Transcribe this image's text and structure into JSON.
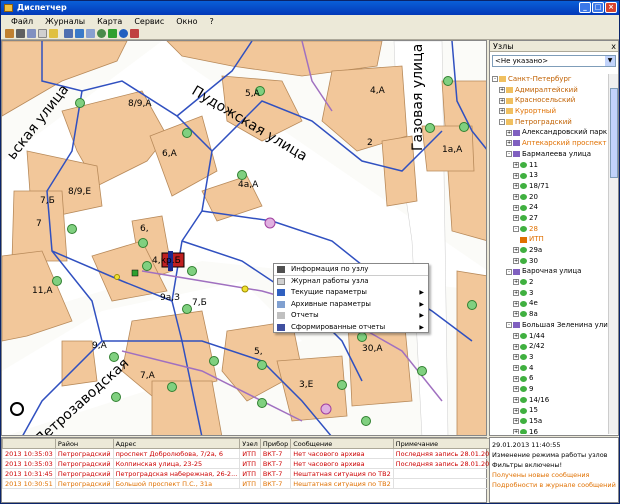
{
  "window": {
    "title": "Диспетчер",
    "buttons": {
      "min": "_",
      "max": "□",
      "close": "×"
    }
  },
  "menu": [
    "Файл",
    "Журналы",
    "Карта",
    "Сервис",
    "Окно",
    "?"
  ],
  "map": {
    "streets": [
      "Пудожская улица",
      "Газовая улица",
      "Петрозаводская",
      "ьская улица"
    ],
    "buildings": [
      "5,А",
      "4,А",
      "8/9,А",
      "6,А",
      "2",
      "1а,А",
      "8/9,Е",
      "7,Б",
      "4а,А",
      "7",
      "6,",
      "4,кр.Б",
      "11,А",
      "9а,З",
      "7,Б",
      "9,А",
      "7,А",
      "5,",
      "3,Е",
      "30,А"
    ]
  },
  "context_menu": [
    {
      "label": "Информация по узлу",
      "sub": false
    },
    {
      "label": "Журнал работы узла",
      "sub": false
    },
    {
      "label": "Текущие параметры",
      "sub": true
    },
    {
      "label": "Архивные параметры",
      "sub": true
    },
    {
      "label": "Отчеты",
      "sub": true
    },
    {
      "label": "Сформированные отчеты",
      "sub": true
    }
  ],
  "right_panel": {
    "title": "Узлы",
    "close": "x",
    "combo_value": "<Не указано>",
    "tree": [
      {
        "label": "Санкт-Петербург",
        "lvl": 0,
        "kind": "folder",
        "color": "#c06000",
        "exp": "-"
      },
      {
        "label": "Адмиралтейский",
        "lvl": 1,
        "kind": "folder",
        "color": "#c06000",
        "exp": "+"
      },
      {
        "label": "Красносельский",
        "lvl": 1,
        "kind": "folder",
        "color": "#c06000",
        "exp": "+"
      },
      {
        "label": "Курортный",
        "lvl": 1,
        "kind": "folder",
        "color": "#e07000",
        "exp": "+"
      },
      {
        "label": "Петроградский",
        "lvl": 1,
        "kind": "folder",
        "color": "#c06000",
        "exp": "-"
      },
      {
        "label": "Александровский парк",
        "lvl": 2,
        "kind": "street",
        "color": "#000",
        "exp": "+"
      },
      {
        "label": "Аптекарский проспект",
        "lvl": 2,
        "kind": "street",
        "color": "#e07000",
        "exp": "+"
      },
      {
        "label": "Бармалеева улица",
        "lvl": 2,
        "kind": "street",
        "color": "#000",
        "exp": "-"
      },
      {
        "label": "11",
        "lvl": 3,
        "kind": "node",
        "color": "#000",
        "exp": "+"
      },
      {
        "label": "13",
        "lvl": 3,
        "kind": "node",
        "color": "#000",
        "exp": "+"
      },
      {
        "label": "18/71",
        "lvl": 3,
        "kind": "node",
        "color": "#000",
        "exp": "+"
      },
      {
        "label": "20",
        "lvl": 3,
        "kind": "node",
        "color": "#000",
        "exp": "+"
      },
      {
        "label": "24",
        "lvl": 3,
        "kind": "node",
        "color": "#000",
        "exp": "+"
      },
      {
        "label": "27",
        "lvl": 3,
        "kind": "node",
        "color": "#000",
        "exp": "+"
      },
      {
        "label": "28",
        "lvl": 3,
        "kind": "node",
        "color": "#e07000",
        "exp": "-"
      },
      {
        "label": "ИТП",
        "lvl": 4,
        "kind": "itp",
        "color": "#e07000",
        "exp": ""
      },
      {
        "label": "29а",
        "lvl": 3,
        "kind": "node",
        "color": "#000",
        "exp": "+"
      },
      {
        "label": "30",
        "lvl": 3,
        "kind": "node",
        "color": "#000",
        "exp": "+"
      },
      {
        "label": "Барочная улица",
        "lvl": 2,
        "kind": "street",
        "color": "#000",
        "exp": "-"
      },
      {
        "label": "2",
        "lvl": 3,
        "kind": "node",
        "color": "#000",
        "exp": "+"
      },
      {
        "label": "3",
        "lvl": 3,
        "kind": "node",
        "color": "#000",
        "exp": "+"
      },
      {
        "label": "4е",
        "lvl": 3,
        "kind": "node",
        "color": "#000",
        "exp": "+"
      },
      {
        "label": "8а",
        "lvl": 3,
        "kind": "node",
        "color": "#000",
        "exp": "+"
      },
      {
        "label": "Большая Зеленина улица",
        "lvl": 2,
        "kind": "street",
        "color": "#000",
        "exp": "-"
      },
      {
        "label": "1/44",
        "lvl": 3,
        "kind": "node",
        "color": "#000",
        "exp": "+"
      },
      {
        "label": "2/42",
        "lvl": 3,
        "kind": "node",
        "color": "#000",
        "exp": "+"
      },
      {
        "label": "3",
        "lvl": 3,
        "kind": "node",
        "color": "#000",
        "exp": "+"
      },
      {
        "label": "4",
        "lvl": 3,
        "kind": "node",
        "color": "#000",
        "exp": "+"
      },
      {
        "label": "6",
        "lvl": 3,
        "kind": "node",
        "color": "#000",
        "exp": "+"
      },
      {
        "label": "9",
        "lvl": 3,
        "kind": "node",
        "color": "#000",
        "exp": "+"
      },
      {
        "label": "14/16",
        "lvl": 3,
        "kind": "node",
        "color": "#000",
        "exp": "+"
      },
      {
        "label": "15",
        "lvl": 3,
        "kind": "node",
        "color": "#000",
        "exp": "+"
      },
      {
        "label": "15а",
        "lvl": 3,
        "kind": "node",
        "color": "#000",
        "exp": "+"
      },
      {
        "label": "16",
        "lvl": 3,
        "kind": "node",
        "color": "#000",
        "exp": "+"
      },
      {
        "label": "17",
        "lvl": 3,
        "kind": "node",
        "color": "#000",
        "exp": "+"
      }
    ]
  },
  "log": {
    "columns": [
      "",
      "Район",
      "Адрес",
      "Узел",
      "Прибор",
      "Сообщение",
      "Примечание"
    ],
    "rows": [
      {
        "cls": "red",
        "cells": [
          "2013 10:35:03",
          "Петроградский",
          "проспект Добролюбова, 7/2а, 6",
          "ИТП",
          "ВКТ-7",
          "Нет часового архива",
          "Последняя запись 28.01.2013 7:00:00"
        ]
      },
      {
        "cls": "red",
        "cells": [
          "2013 10:35:03",
          "Петроградский",
          "Колпинская улица, 23-25",
          "ИТП",
          "ВКТ-7",
          "Нет часового архива",
          "Последняя запись 28.01.2013 7:00:00"
        ]
      },
      {
        "cls": "red",
        "cells": [
          "2013 10:31:45",
          "Петроградский",
          "Петроградская набережная, 26-2...",
          "ИТП",
          "ВКТ-7",
          "Нештатная ситуация по ТВ2",
          ""
        ]
      },
      {
        "cls": "orange",
        "cells": [
          "2013 10:30:51",
          "Петроградский",
          "Большой проспект П.С., 31а",
          "ИТП",
          "ВКТ-7",
          "Нештатная ситуация по ТВ2",
          ""
        ]
      }
    ]
  },
  "status_panel": {
    "lines": [
      {
        "text": "29.01.2013 11:40:55",
        "color": "#000"
      },
      {
        "text": "Изменение режима работы узлов",
        "color": "#000"
      },
      {
        "text": "Фильтры включены!",
        "color": "#000"
      },
      {
        "text": "Получены новые сообщения",
        "color": "#e07000"
      },
      {
        "text": "Подробности в журнале сообщений",
        "color": "#e07000"
      }
    ]
  }
}
